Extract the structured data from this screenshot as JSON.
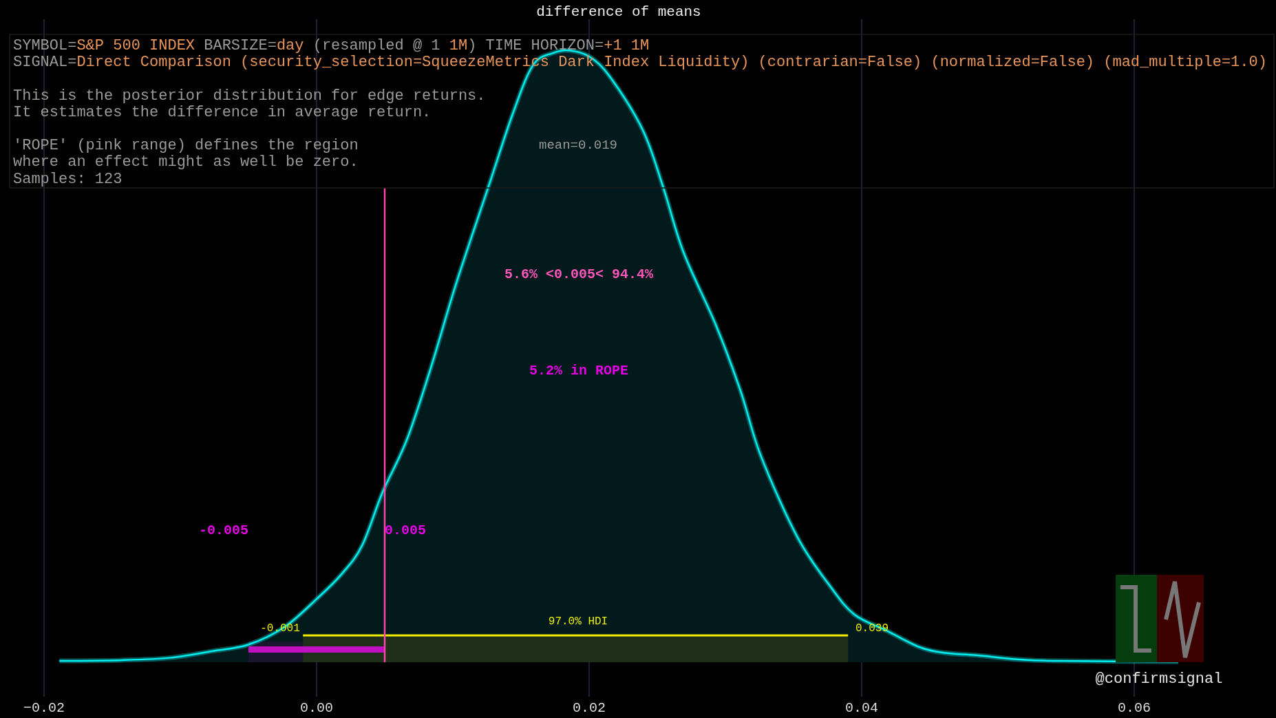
{
  "title": "difference of means",
  "info": {
    "paragraphs": [
      [
        [
          {
            "kind": "key",
            "text": "SYMBOL="
          },
          {
            "kind": "value",
            "text": "S&P 500 INDEX"
          },
          {
            "kind": "key",
            "text": " BARSIZE="
          },
          {
            "kind": "value",
            "text": "day"
          },
          {
            "kind": "key",
            "text": " (resampled @ 1 "
          },
          {
            "kind": "value",
            "text": "1M"
          },
          {
            "kind": "key",
            "text": ") TIME HORIZON="
          },
          {
            "kind": "value",
            "text": "+1 1M"
          }
        ],
        [
          {
            "kind": "key",
            "text": "SIGNAL="
          },
          {
            "kind": "value",
            "text": "Direct Comparison (security_selection=SqueezeMetrics Dark Index Liquidity) (contrarian=False) (normalized=False) (mad_multiple=1.0)"
          }
        ]
      ],
      [
        [
          {
            "kind": "key",
            "text": "This is the posterior distribution for edge returns."
          }
        ],
        [
          {
            "kind": "key",
            "text": "It estimates the difference in average return."
          }
        ]
      ],
      [
        [
          {
            "kind": "key",
            "text": "'ROPE' (pink range) defines the region"
          }
        ],
        [
          {
            "kind": "key",
            "text": "where an effect might as well be zero."
          }
        ],
        [
          {
            "kind": "key",
            "text": "Samples: 123"
          }
        ]
      ]
    ]
  },
  "mean_label": "mean=0.019",
  "probability_label": "5.6% <0.005< 94.4%",
  "rope": {
    "label": "5.2% in ROPE",
    "low": "-0.005",
    "high": "0.005"
  },
  "hdi": {
    "label": "97.0% HDI",
    "low": "-0.001",
    "high": "0.039"
  },
  "x_ticks": [
    "−0.02",
    "0.00",
    "0.02",
    "0.04",
    "0.06"
  ],
  "credit": "@confirmsignal"
}
